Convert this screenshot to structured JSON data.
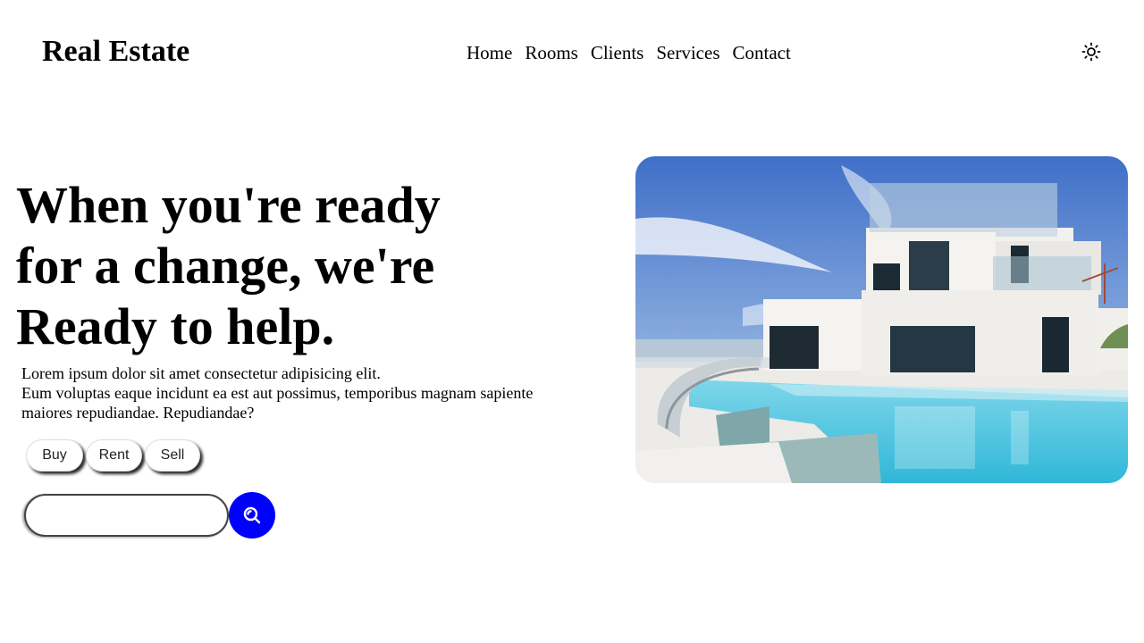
{
  "brand": {
    "name": "Real Estate"
  },
  "nav": {
    "items": [
      {
        "label": "Home"
      },
      {
        "label": "Rooms"
      },
      {
        "label": "Clients"
      },
      {
        "label": "Services"
      },
      {
        "label": "Contact"
      }
    ]
  },
  "header": {
    "theme_icon": "sun-icon"
  },
  "hero": {
    "title_lines": [
      "When you're ready",
      "for a change, we're",
      "Ready to help."
    ],
    "text_lines": [
      "Lorem ipsum dolor sit amet consectetur adipisicing elit.",
      "Eum voluptas eaque incidunt ea est aut possimus, temporibus magnam sapiente",
      "maiores repudiandae. Repudiandae?"
    ],
    "tabs": [
      {
        "label": "Buy"
      },
      {
        "label": "Rent"
      },
      {
        "label": "Sell"
      }
    ],
    "search": {
      "value": "",
      "placeholder": "",
      "icon": "search-icon"
    },
    "image": {
      "subject": "modern white villa with swimming pool"
    }
  },
  "colors": {
    "accent": "#0000ff",
    "text": "#000000",
    "background": "#ffffff"
  }
}
